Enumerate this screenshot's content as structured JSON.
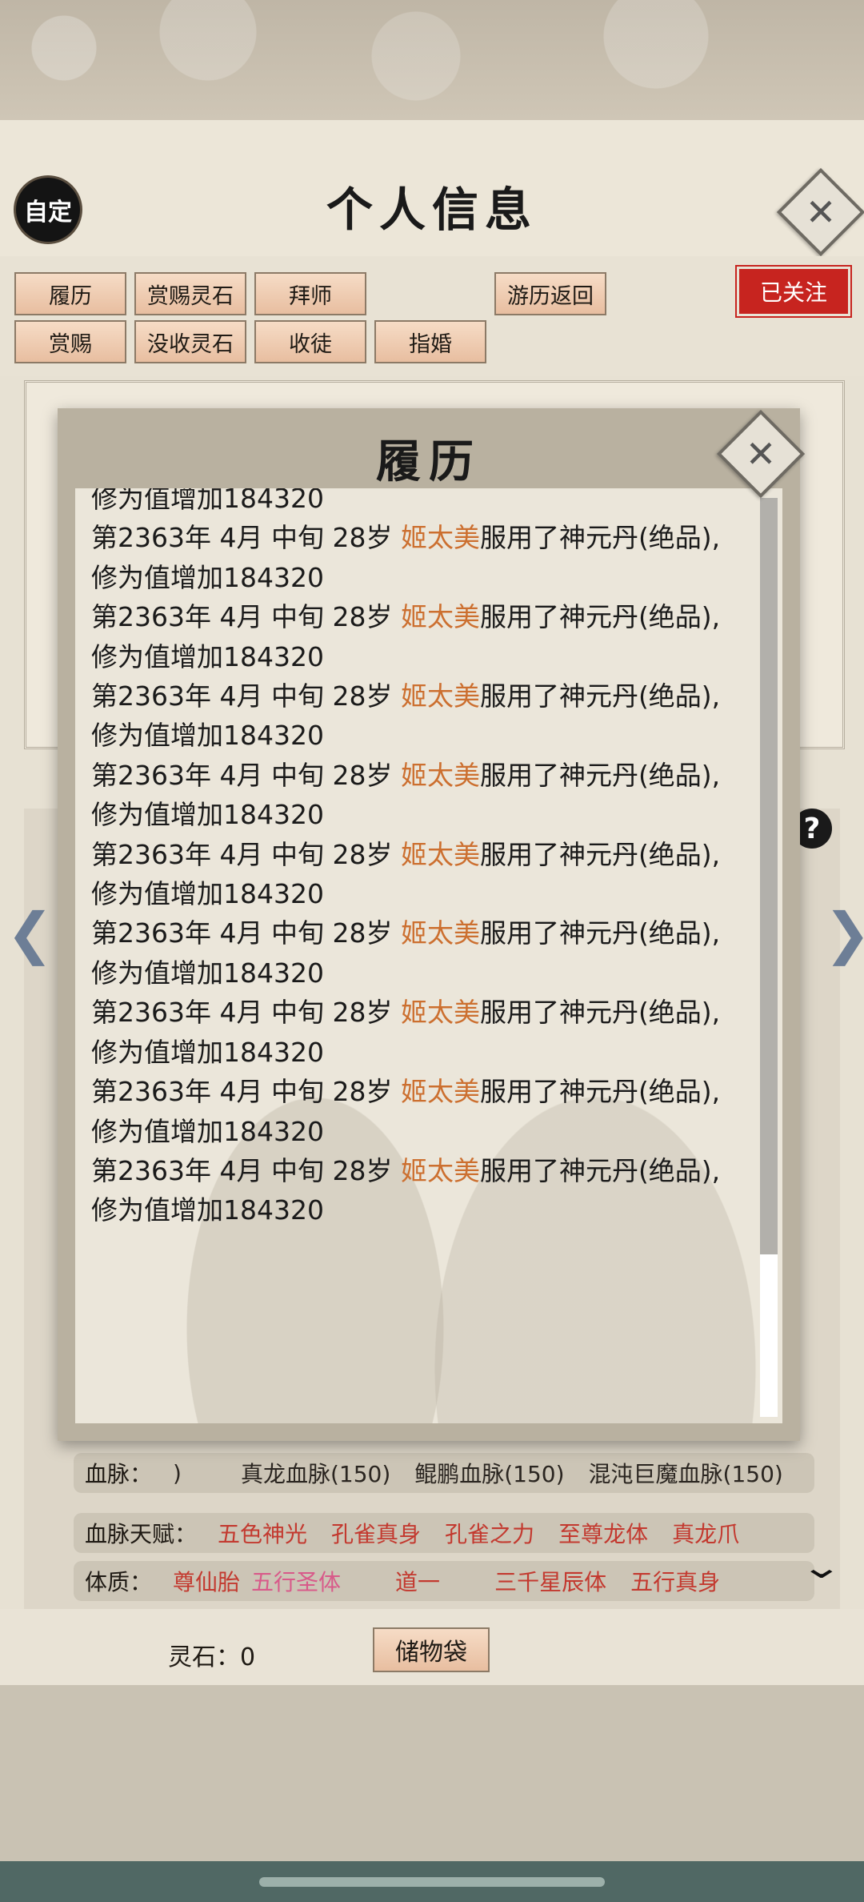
{
  "header": {
    "badge": "自定",
    "title": "个人信息"
  },
  "tabs": {
    "row1": [
      "履历",
      "赏赐灵石",
      "拜师"
    ],
    "travel_return": "游历返回",
    "row2": [
      "赏赐",
      "没收灵石",
      "收徒",
      "指婚"
    ],
    "followed": "已关注"
  },
  "background_panel": {
    "bloodline": {
      "label": "血脉：",
      "paren": ")",
      "items": [
        "真龙血脉(150)",
        "鲲鹏血脉(150)",
        "混沌巨魔血脉(150)"
      ]
    },
    "bloodline_talent": {
      "label": "血脉天赋：",
      "items": [
        "五色神光",
        "孔雀真身",
        "孔雀之力",
        "至尊龙体",
        "真龙爪"
      ]
    },
    "physique": {
      "label": "体质：",
      "items": [
        "尊仙胎",
        "五行圣体",
        "道一",
        "三千星辰体",
        "五行真身"
      ]
    },
    "spirit_stone": "灵石：0",
    "storage_button": "储物袋"
  },
  "modal": {
    "title": "履历",
    "log": {
      "partial_first": "修为值增加184320",
      "entries": [
        {
          "prefix": "第2363年 4月 中旬 28岁 ",
          "name": "姬太美",
          "action": "服用了神元丹(绝品),",
          "effect": "修为值增加184320"
        },
        {
          "prefix": "第2363年 4月 中旬 28岁 ",
          "name": "姬太美",
          "action": "服用了神元丹(绝品),",
          "effect": "修为值增加184320"
        },
        {
          "prefix": "第2363年 4月 中旬 28岁 ",
          "name": "姬太美",
          "action": "服用了神元丹(绝品),",
          "effect": "修为值增加184320"
        },
        {
          "prefix": "第2363年 4月 中旬 28岁 ",
          "name": "姬太美",
          "action": "服用了神元丹(绝品),",
          "effect": "修为值增加184320"
        },
        {
          "prefix": "第2363年 4月 中旬 28岁 ",
          "name": "姬太美",
          "action": "服用了神元丹(绝品),",
          "effect": "修为值增加184320"
        },
        {
          "prefix": "第2363年 4月 中旬 28岁 ",
          "name": "姬太美",
          "action": "服用了神元丹(绝品),",
          "effect": "修为值增加184320"
        },
        {
          "prefix": "第2363年 4月 中旬 28岁 ",
          "name": "姬太美",
          "action": "服用了神元丹(绝品),",
          "effect": "修为值增加184320"
        },
        {
          "prefix": "第2363年 4月 中旬 28岁 ",
          "name": "姬太美",
          "action": "服用了神元丹(绝品),",
          "effect": "修为值增加184320"
        },
        {
          "prefix": "第2363年 4月 中旬 28岁 ",
          "name": "姬太美",
          "action": "服用了神元丹(绝品),",
          "effect": "修为值增加184320"
        }
      ]
    }
  },
  "icons": {
    "close": "close-icon",
    "help": "help-icon",
    "prev": "chevron-left-icon",
    "next": "chevron-right-icon",
    "expand": "chevron-down-icon"
  },
  "colors": {
    "name_highlight": "#cc6f2f",
    "followed_badge": "#c7241f",
    "tag_red": "#c3392f"
  }
}
